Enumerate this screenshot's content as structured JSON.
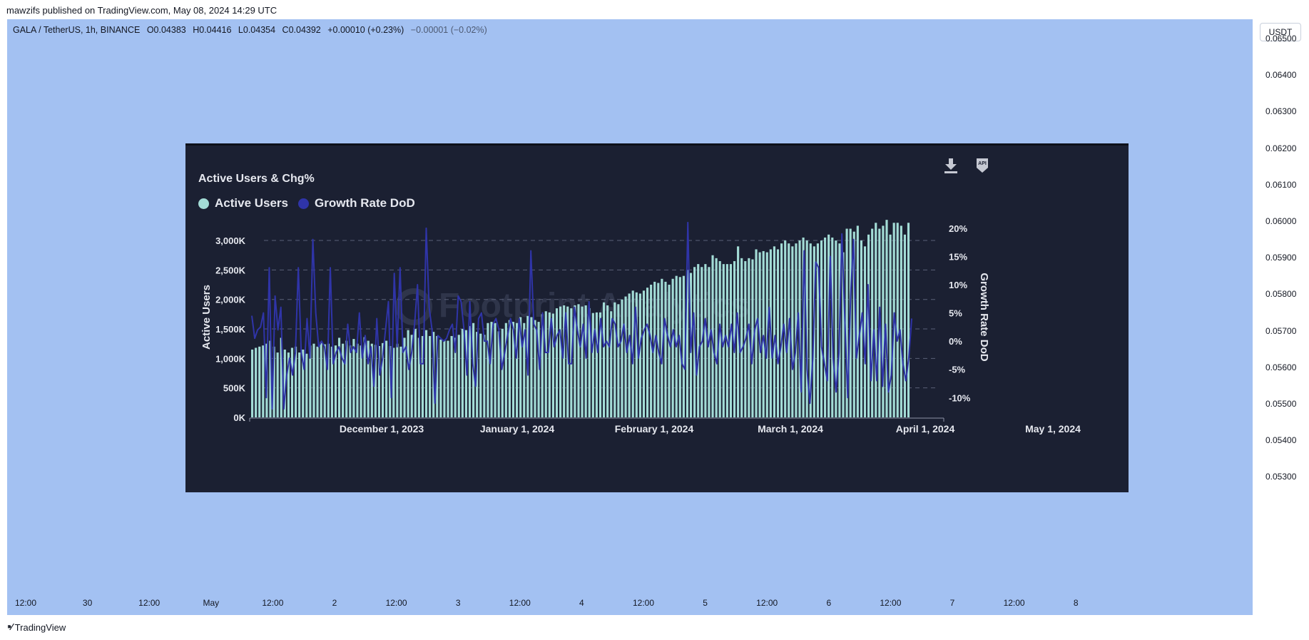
{
  "publish_line": "mawzifs published on TradingView.com, May 08, 2024 14:29 UTC",
  "ohlc": {
    "symbol": "GALA / TetherUS, 1h, BINANCE",
    "open": "O0.04383",
    "high": "H0.04416",
    "low": "L0.04354",
    "close": "C0.04392",
    "change": "+0.00010 (+0.23%)",
    "extra": "−0.00001 (−0.02%)"
  },
  "currency_button": "USDT",
  "price_axis": [
    "0.06500",
    "0.06400",
    "0.06300",
    "0.06200",
    "0.06100",
    "0.06000",
    "0.05900",
    "0.05800",
    "0.05700",
    "0.05600",
    "0.05500",
    "0.05400",
    "0.05300"
  ],
  "time_axis": [
    "12:00",
    "30",
    "12:00",
    "May",
    "12:00",
    "2",
    "12:00",
    "3",
    "12:00",
    "4",
    "12:00",
    "5",
    "12:00",
    "6",
    "12:00",
    "7",
    "12:00",
    "8"
  ],
  "footer_brand": "TradingView",
  "colors": {
    "plot_bg": "#a3c1f2",
    "card_bg": "#1b2032",
    "bar": "#a3dcd6",
    "line": "#2f34a8",
    "text_light": "#e6e8ef"
  },
  "card": {
    "title": "Active Users & Chg%",
    "icons": [
      "download-icon",
      "api-icon"
    ],
    "watermark": "Footprint Analytics"
  },
  "chart_data": {
    "type": "bar",
    "title": "Active Users & Chg%",
    "legend": [
      "Active Users",
      "Growth Rate DoD"
    ],
    "legend_position": "top-left",
    "ylabel": "Active Users",
    "y2label": "Growth Rate DoD",
    "ylim": [
      0,
      3400000
    ],
    "y2lim": [
      -13.5,
      22
    ],
    "y_ticks": [
      "0K",
      "500K",
      "1,000K",
      "1,500K",
      "2,000K",
      "2,500K",
      "3,000K"
    ],
    "y2_ticks": [
      "-10%",
      "-5%",
      "0%",
      "5%",
      "10%",
      "15%",
      "20%"
    ],
    "x_ticks": [
      "December 1, 2023",
      "January 1, 2024",
      "February 1, 2024",
      "March 1, 2024",
      "April 1, 2024",
      "May 1, 2024"
    ],
    "grid": true,
    "series": [
      {
        "name": "Active Users",
        "type": "bar",
        "values": [
          1150,
          1180,
          1200,
          1220,
          1250,
          1300,
          1200,
          1100,
          1350,
          1150,
          1100,
          1180,
          1200,
          1100,
          1150,
          1080,
          1220,
          1250,
          1200,
          1280,
          1240,
          1250,
          1200,
          1220,
          1350,
          1250,
          1300,
          1220,
          1330,
          1250,
          1220,
          1360,
          1300,
          1250,
          1230,
          1210,
          1260,
          1300,
          1210,
          1180,
          1250,
          1200,
          1350,
          1480,
          1400,
          1500,
          1350,
          1380,
          1480,
          1380,
          1450,
          1380,
          1320,
          1310,
          1300,
          1380,
          1350,
          1400,
          1500,
          1480,
          1550,
          1600,
          1450,
          1420,
          1400,
          1600,
          1620,
          1600,
          1460,
          1500,
          1600,
          1650,
          1620,
          1600,
          1700,
          1600,
          1720,
          1700,
          1650,
          1620,
          1750,
          1800,
          1780,
          1760,
          1850,
          1880,
          1900,
          1880,
          1850,
          1900,
          1920,
          1880,
          1900,
          1850,
          1770,
          1780,
          1780,
          1950,
          1900,
          1800,
          1950,
          1920,
          2000,
          2050,
          2100,
          2150,
          2120,
          2100,
          2150,
          2200,
          2250,
          2300,
          2280,
          2350,
          2300,
          2250,
          2350,
          2400,
          2380,
          2400,
          2500,
          2450,
          2550,
          2600,
          2550,
          2600,
          2550,
          2750,
          2700,
          2650,
          2600,
          2600,
          2600,
          2650,
          2900,
          2700,
          2650,
          2700,
          2680,
          2850,
          2800,
          2820,
          2800,
          2850,
          2900,
          2850,
          2950,
          3000,
          2950,
          2900,
          2950,
          3000,
          3050,
          3000,
          2950,
          2900,
          2950,
          3000,
          3050,
          3100,
          3050,
          3000,
          2950,
          2800,
          3200,
          3200,
          3150,
          3250,
          3000,
          2900,
          3100,
          3200,
          3300,
          3200,
          3250,
          3350,
          3100,
          3300,
          3300,
          3250,
          3100,
          3300
        ],
        "unit": "K"
      },
      {
        "name": "Growth Rate DoD",
        "type": "line",
        "unit": "%",
        "values": [
          4.5,
          0.5,
          2,
          2.5,
          5,
          -10,
          13,
          -12,
          8,
          2,
          6,
          -12,
          -6,
          -3,
          -6,
          -2,
          13,
          -2,
          -5,
          4,
          -3,
          18,
          5,
          -1,
          0,
          -1,
          -5,
          13,
          -4,
          -2,
          -1,
          -3,
          -4,
          3,
          -2,
          -1,
          -2,
          5,
          -3,
          1,
          -4,
          -1,
          -8,
          4,
          -6,
          -3,
          2,
          7,
          -10,
          12,
          -1,
          13,
          -2,
          -1,
          -5,
          -2,
          3,
          10,
          -4,
          -4,
          20,
          6,
          2,
          -11,
          1,
          0.5,
          0,
          0.5,
          2,
          3,
          -2,
          8,
          7,
          2,
          -6,
          7,
          -4,
          -8,
          4,
          5,
          0,
          0,
          -4,
          3,
          4,
          2,
          -5,
          -2,
          1,
          4,
          2,
          -3,
          4,
          -1,
          2,
          -6,
          16,
          3,
          2,
          -5,
          5,
          -2,
          -2,
          4,
          -1,
          1,
          2,
          -3,
          5,
          -4,
          -4,
          6,
          2,
          -1,
          3,
          -3,
          7,
          -2,
          2,
          -2,
          4,
          -1,
          0,
          -1,
          4,
          3,
          -1,
          0,
          3,
          -2,
          1,
          -4,
          6,
          -3,
          0.5,
          2,
          3,
          1,
          -2,
          1,
          -2,
          -4,
          4,
          1,
          -1,
          2,
          -1,
          1,
          -4,
          -5,
          21,
          -2,
          5,
          -6,
          -1,
          0,
          4,
          -1,
          2,
          -2,
          -4,
          3,
          -1,
          1,
          -1,
          3,
          -2,
          5,
          -2,
          -1,
          0.5,
          3,
          -4,
          2,
          4,
          -2,
          1,
          -3,
          6,
          -3,
          1,
          -4,
          -1,
          3,
          -2,
          4,
          -5,
          -2,
          5,
          -9,
          16,
          -5,
          -11,
          -3,
          14,
          13,
          -1,
          -4,
          -7,
          15,
          -3,
          -9,
          -2,
          19,
          4,
          -10,
          8,
          18,
          -3,
          1,
          5,
          -4,
          10,
          -7,
          2,
          -7,
          6,
          -8,
          3,
          -9,
          -6,
          5,
          0,
          2,
          -4,
          -7,
          -3,
          4
        ]
      }
    ]
  }
}
